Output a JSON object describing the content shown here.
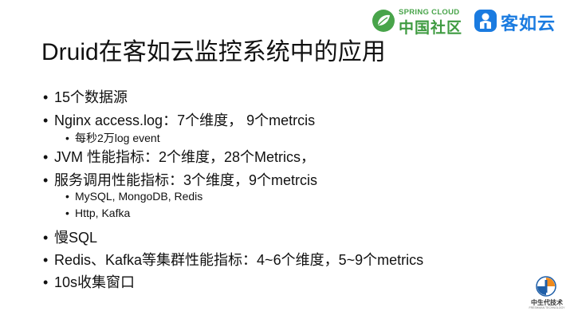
{
  "logos": {
    "spring_cloud_top": "SPRING CLOUD",
    "spring_cloud_bottom": "中国社区",
    "kerun_name": "客如云",
    "zhongshengdai_name": "中生代技术",
    "zhongshengdai_sub": "FRESHMAN TECHNOLOGY"
  },
  "title": "Druid在客如云监控系统中的应用",
  "bullets": [
    {
      "level": 1,
      "text": "15个数据源"
    },
    {
      "level": 1,
      "text": "Nginx access.log：7个维度， 9个metrcis"
    },
    {
      "level": 2,
      "text": "每秒2万log event"
    },
    {
      "level": 1,
      "text": "JVM 性能指标：2个维度，28个Metrics，"
    },
    {
      "level": 1,
      "text": "服务调用性能指标：3个维度，9个metrcis"
    },
    {
      "level": 2,
      "text": "MySQL, MongoDB, Redis"
    },
    {
      "level": 2,
      "text": "Http, Kafka"
    },
    {
      "level": 1,
      "text": "慢SQL"
    },
    {
      "level": 1,
      "text": "Redis、Kafka等集群性能指标：4~6个维度，5~9个metrics"
    },
    {
      "level": 1,
      "text": "10s收集窗口"
    }
  ],
  "bullet_symbol": "•",
  "colors": {
    "spring_green": "#48a44a",
    "kerun_blue": "#1a7be0",
    "text": "#111111"
  }
}
